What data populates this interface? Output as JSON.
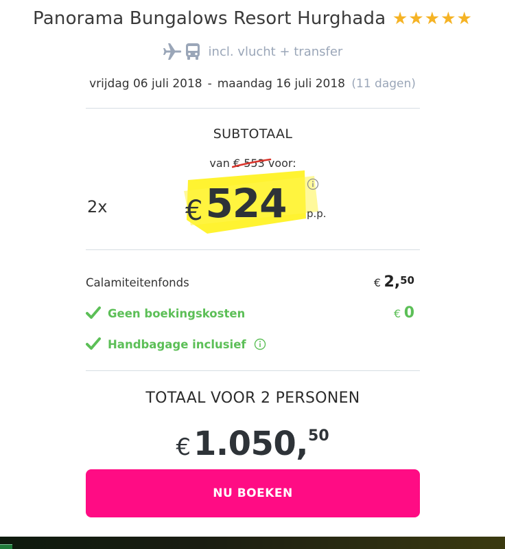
{
  "header": {
    "hotel_name": "Panorama Bungalows Resort Hurghada",
    "stars": 5,
    "incl_text": "incl. vlucht + transfer",
    "date_from": "vrijdag 06 juli 2018",
    "date_sep": "-",
    "date_to": "maandag 16 juli 2018",
    "duration": "(11 dagen)"
  },
  "subtotal": {
    "title": "SUBTOTAAL",
    "van_prefix": "van",
    "old_price": "€ 553",
    "van_suffix": "voor:",
    "persons": "2x",
    "currency": "€",
    "price": "524",
    "per_person": "p.p."
  },
  "extras": [
    {
      "label": "Calamiteitenfonds",
      "currency": "€",
      "amount_int": "2,",
      "amount_dec": "50"
    },
    {
      "label": "Geen boekingskosten",
      "currency": "€",
      "amount_int": "0"
    },
    {
      "label": "Handbagage inclusief"
    }
  ],
  "total": {
    "title": "TOTAAL VOOR 2 PERSONEN",
    "currency": "€",
    "amount_int": "1.050,",
    "amount_dec": "50"
  },
  "cta": {
    "label": "NU BOEKEN"
  },
  "colors": {
    "star": "#f5b325",
    "accent_pink": "#ff0c84",
    "green": "#5cbf57",
    "highlight_yellow": "#fff21f",
    "muted": "#9aa6b8",
    "strike_red": "#d9342b"
  },
  "icons": [
    "star-icon",
    "plane-icon",
    "bus-icon",
    "info-icon",
    "check-icon"
  ]
}
